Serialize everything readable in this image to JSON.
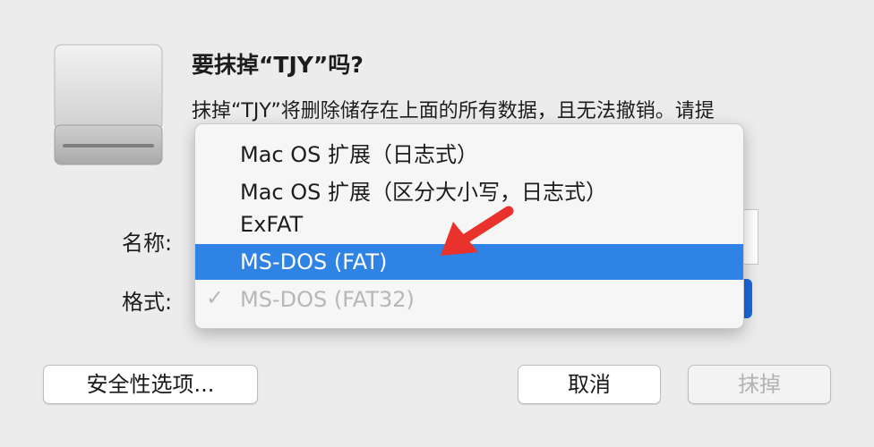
{
  "dialog": {
    "title": "要抹掉“TJY”吗?",
    "message": "抹掉“TJY”将删除储存在上面的所有数据，且无法撤销。请提",
    "name_label": "名称:",
    "format_label": "格式:"
  },
  "menu": {
    "items": [
      {
        "label": "Mac OS 扩展（日志式）"
      },
      {
        "label": "Mac OS 扩展（区分大小写，日志式）"
      },
      {
        "label": "ExFAT"
      },
      {
        "label": "MS-DOS (FAT)"
      },
      {
        "label": "MS-DOS (FAT32)"
      }
    ],
    "highlighted_index": 3,
    "checked_index": 4,
    "check_glyph": "✓"
  },
  "buttons": {
    "security": "安全性选项...",
    "cancel": "取消",
    "erase": "抹掉"
  },
  "colors": {
    "highlight": "#2e83e5",
    "arrow": "#e8322b"
  }
}
